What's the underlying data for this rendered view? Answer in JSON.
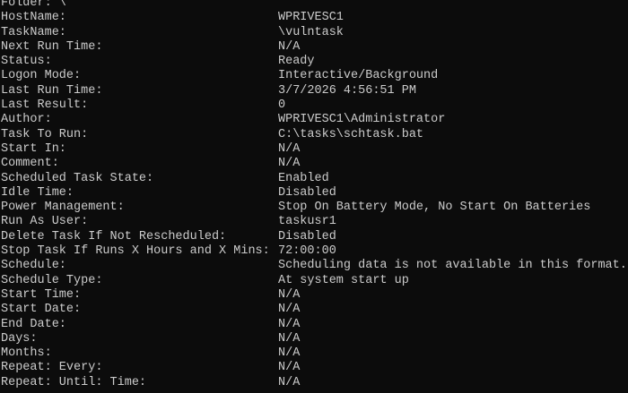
{
  "console": {
    "folder_line": "Folder: \\",
    "rows": [
      {
        "key": "HostName:",
        "value": "WPRIVESC1"
      },
      {
        "key": "TaskName:",
        "value": "\\vulntask"
      },
      {
        "key": "Next Run Time:",
        "value": "N/A"
      },
      {
        "key": "Status:",
        "value": "Ready"
      },
      {
        "key": "Logon Mode:",
        "value": "Interactive/Background"
      },
      {
        "key": "Last Run Time:",
        "value": "3/7/2026 4:56:51 PM"
      },
      {
        "key": "Last Result:",
        "value": "0"
      },
      {
        "key": "Author:",
        "value": "WPRIVESC1\\Administrator"
      },
      {
        "key": "Task To Run:",
        "value": "C:\\tasks\\schtask.bat"
      },
      {
        "key": "Start In:",
        "value": "N/A"
      },
      {
        "key": "Comment:",
        "value": "N/A"
      },
      {
        "key": "Scheduled Task State:",
        "value": "Enabled"
      },
      {
        "key": "Idle Time:",
        "value": "Disabled"
      },
      {
        "key": "Power Management:",
        "value": "Stop On Battery Mode, No Start On Batteries"
      },
      {
        "key": "Run As User:",
        "value": "taskusr1"
      },
      {
        "key": "Delete Task If Not Rescheduled:",
        "value": "Disabled"
      },
      {
        "key": "Stop Task If Runs X Hours and X Mins:",
        "value": "72:00:00"
      },
      {
        "key": "Schedule:",
        "value": "Scheduling data is not available in this format."
      },
      {
        "key": "Schedule Type:",
        "value": "At system start up"
      },
      {
        "key": "Start Time:",
        "value": "N/A"
      },
      {
        "key": "Start Date:",
        "value": "N/A"
      },
      {
        "key": "End Date:",
        "value": "N/A"
      },
      {
        "key": "Days:",
        "value": "N/A"
      },
      {
        "key": "Months:",
        "value": "N/A"
      },
      {
        "key": "Repeat: Every:",
        "value": "N/A"
      },
      {
        "key": "Repeat: Until: Time:",
        "value": "N/A"
      }
    ]
  },
  "colors": {
    "background": "#0c0c0c",
    "text": "#cccccc"
  }
}
